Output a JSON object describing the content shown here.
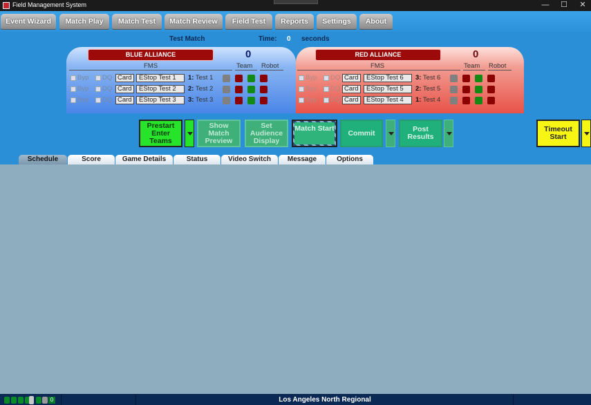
{
  "window": {
    "title": "Field Management System",
    "controls": [
      "—",
      "☐",
      "✕"
    ]
  },
  "menu": [
    "Event Wizard",
    "Match Play",
    "Match Test",
    "Match Review",
    "Field Test",
    "Reports",
    "Settings",
    "About"
  ],
  "match": {
    "name": "Test Match",
    "time_label": "Time:",
    "time_value": "0",
    "time_unit": "seconds"
  },
  "blue": {
    "title": "BLUE ALLIANCE",
    "score": "0",
    "fms": "FMS",
    "team_hdr": "Team",
    "robot_hdr": "Robot",
    "rows": [
      {
        "byp": "Byp",
        "dq": "DQ",
        "card": "Card",
        "estop": "EStop Test 1",
        "station": "1:",
        "team": "Test 1"
      },
      {
        "byp": "Byp",
        "dq": "DQ",
        "card": "Card",
        "estop": "EStop Test 2",
        "station": "2:",
        "team": "Test 2"
      },
      {
        "byp": "Byp",
        "dq": "DQ",
        "card": "Card",
        "estop": "EStop Test 3",
        "station": "3:",
        "team": "Test 3"
      }
    ]
  },
  "red": {
    "title": "RED ALLIANCE",
    "score": "0",
    "fms": "FMS",
    "team_hdr": "Team",
    "robot_hdr": "Robot",
    "rows": [
      {
        "byp": "Byp",
        "dq": "DQ",
        "card": "Card",
        "estop": "EStop Test 6",
        "station": "3:",
        "team": "Test 6"
      },
      {
        "byp": "Byp",
        "dq": "DQ",
        "card": "Card",
        "estop": "EStop Test 5",
        "station": "2:",
        "team": "Test 5"
      },
      {
        "byp": "Byp",
        "dq": "DQ",
        "card": "Card",
        "estop": "EStop Test 4",
        "station": "1:",
        "team": "Test 4"
      }
    ]
  },
  "workflow": {
    "prestart": "Prestart Enter Teams",
    "show_preview": "Show Match Preview",
    "audience": "Set Audience Display",
    "match_start": "Match Start",
    "commit": "Commit",
    "post_results": "Post Results",
    "timeout": "Timeout Start"
  },
  "tabs": [
    "Schedule",
    "Score",
    "Game Details",
    "Status",
    "Video Switch",
    "Message",
    "Options"
  ],
  "statusbar": {
    "count": "0",
    "event": "Los Angeles North Regional"
  },
  "colors": {
    "indicator_red": "#8b0000",
    "indicator_green": "#138a13",
    "indicator_gray": "#808080",
    "active_green": "#27e42a",
    "timeout_yellow": "#f7f514"
  }
}
